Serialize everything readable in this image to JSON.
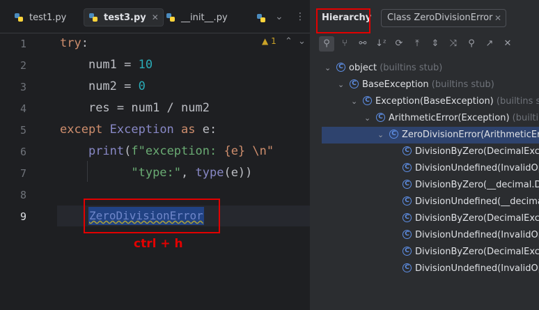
{
  "editor": {
    "tabs": [
      {
        "label": "test1.py",
        "active": false
      },
      {
        "label": "test3.py",
        "active": true
      },
      {
        "label": "__init__.py",
        "active": false
      }
    ],
    "warning_count": "1",
    "line_numbers": [
      "1",
      "2",
      "3",
      "4",
      "5",
      "6",
      "7",
      "8",
      "9"
    ],
    "code": {
      "l1": {
        "kw": "try",
        "rest": ":"
      },
      "l2": {
        "name": "num1",
        "op": " = ",
        "num": "10"
      },
      "l3": {
        "name": "num2",
        "op": " = ",
        "num": "0"
      },
      "l4": {
        "text": "res = num1 / num2"
      },
      "l5": {
        "kw1": "except",
        "cls": "Exception",
        "kw2": "as",
        "rest": " e:"
      },
      "l6": {
        "fn": "print",
        "p": "(",
        "str1": "f\"exception: ",
        "brace": "{e}",
        "str2": " \\n\""
      },
      "l7": {
        "str": "\"type:\"",
        "comma": ", ",
        "fn": "type",
        "rest": "(e))"
      },
      "l9": {
        "token": "ZeroDivisionError"
      }
    },
    "shortcut_hint": "ctrl + h"
  },
  "panel": {
    "hierarchy_tab": "Hierarchy",
    "class_tab": "Class ZeroDivisionError",
    "toolbar_icons": [
      "subtypes-hierarchy-icon",
      "supertypes-hierarchy-icon",
      "class-hierarchy-icon",
      "sort-alpha-icon",
      "refresh-icon",
      "scope-icon",
      "expand-icon",
      "collapse-icon",
      "pin-icon",
      "open-in-new-icon",
      "close-icon"
    ],
    "tree": [
      {
        "label": "object",
        "dim": " (builtins stub)"
      },
      {
        "label": "BaseException",
        "dim": " (builtins stub)"
      },
      {
        "label": "Exception(BaseException)",
        "dim": " (builtins stub)"
      },
      {
        "label": "ArithmeticError(Exception)",
        "dim": " (builtins"
      },
      {
        "label": "ZeroDivisionError(ArithmeticErro",
        "dim": ""
      },
      {
        "label": "DivisionByZero(DecimalExcep",
        "dim": ""
      },
      {
        "label": "DivisionUndefined(InvalidOpe",
        "dim": ""
      },
      {
        "label": "DivisionByZero(__decimal.De",
        "dim": ""
      },
      {
        "label": "DivisionUndefined(__decimal",
        "dim": ""
      },
      {
        "label": "DivisionByZero(DecimalExcep",
        "dim": ""
      },
      {
        "label": "DivisionUndefined(InvalidOpe",
        "dim": ""
      },
      {
        "label": "DivisionByZero(DecimalExcep",
        "dim": ""
      },
      {
        "label": "DivisionUndefined(InvalidOpe",
        "dim": ""
      }
    ]
  }
}
